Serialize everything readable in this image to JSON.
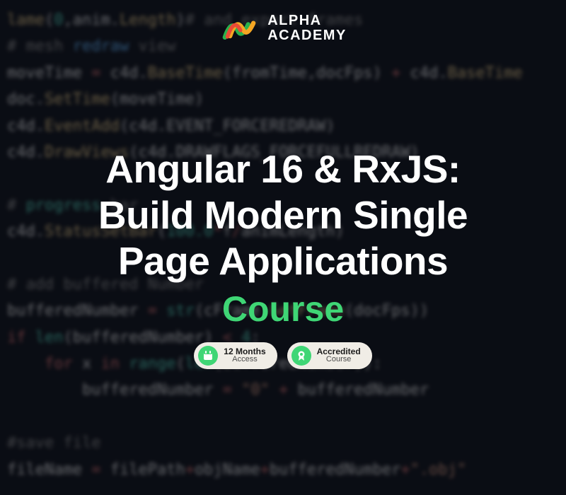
{
  "logo": {
    "line1": "ALPHA",
    "line2": "ACADEMY"
  },
  "title_line1": "Angular 16 & RxJS:",
  "title_line2": "Build Modern Single",
  "title_line3": "Page Applications",
  "subtitle": "Course",
  "badges": [
    {
      "title": "12 Months",
      "sub": "Access"
    },
    {
      "title": "Accredited",
      "sub": "Course"
    }
  ],
  "background_code_lines": [
    "lame(0,anim.Length)# and export frames",
    "# mesh redraw",
    "moveTime = c4d.BaseTime(fromTime,docFps) + c4d.BaseTime",
    "doc.SetTime(moveTime)",
    "c4d.EventAdd(c4d.EVENT_FORCEREDRAW)",
    "c4d.DrawViews(c4d.DRAWFLAGS_FORCEFULLREDRAW)",
    "",
    "# progress bar",
    "c4d.StatusSetBar(100.0*f/animLength)",
    "",
    "# add buffered Number",
    "bufferedNumber = str(cFrame.GetFrame(docFps))",
    "if len(bufferedNumber) < 4:",
    "    for x in range(len(bufferedNumber)):",
    "        bufferedNumber = \"0\" + bufferedNumber",
    "",
    "#save file",
    "fileName = filePath+objName+bufferedNumber+\".obj\""
  ]
}
